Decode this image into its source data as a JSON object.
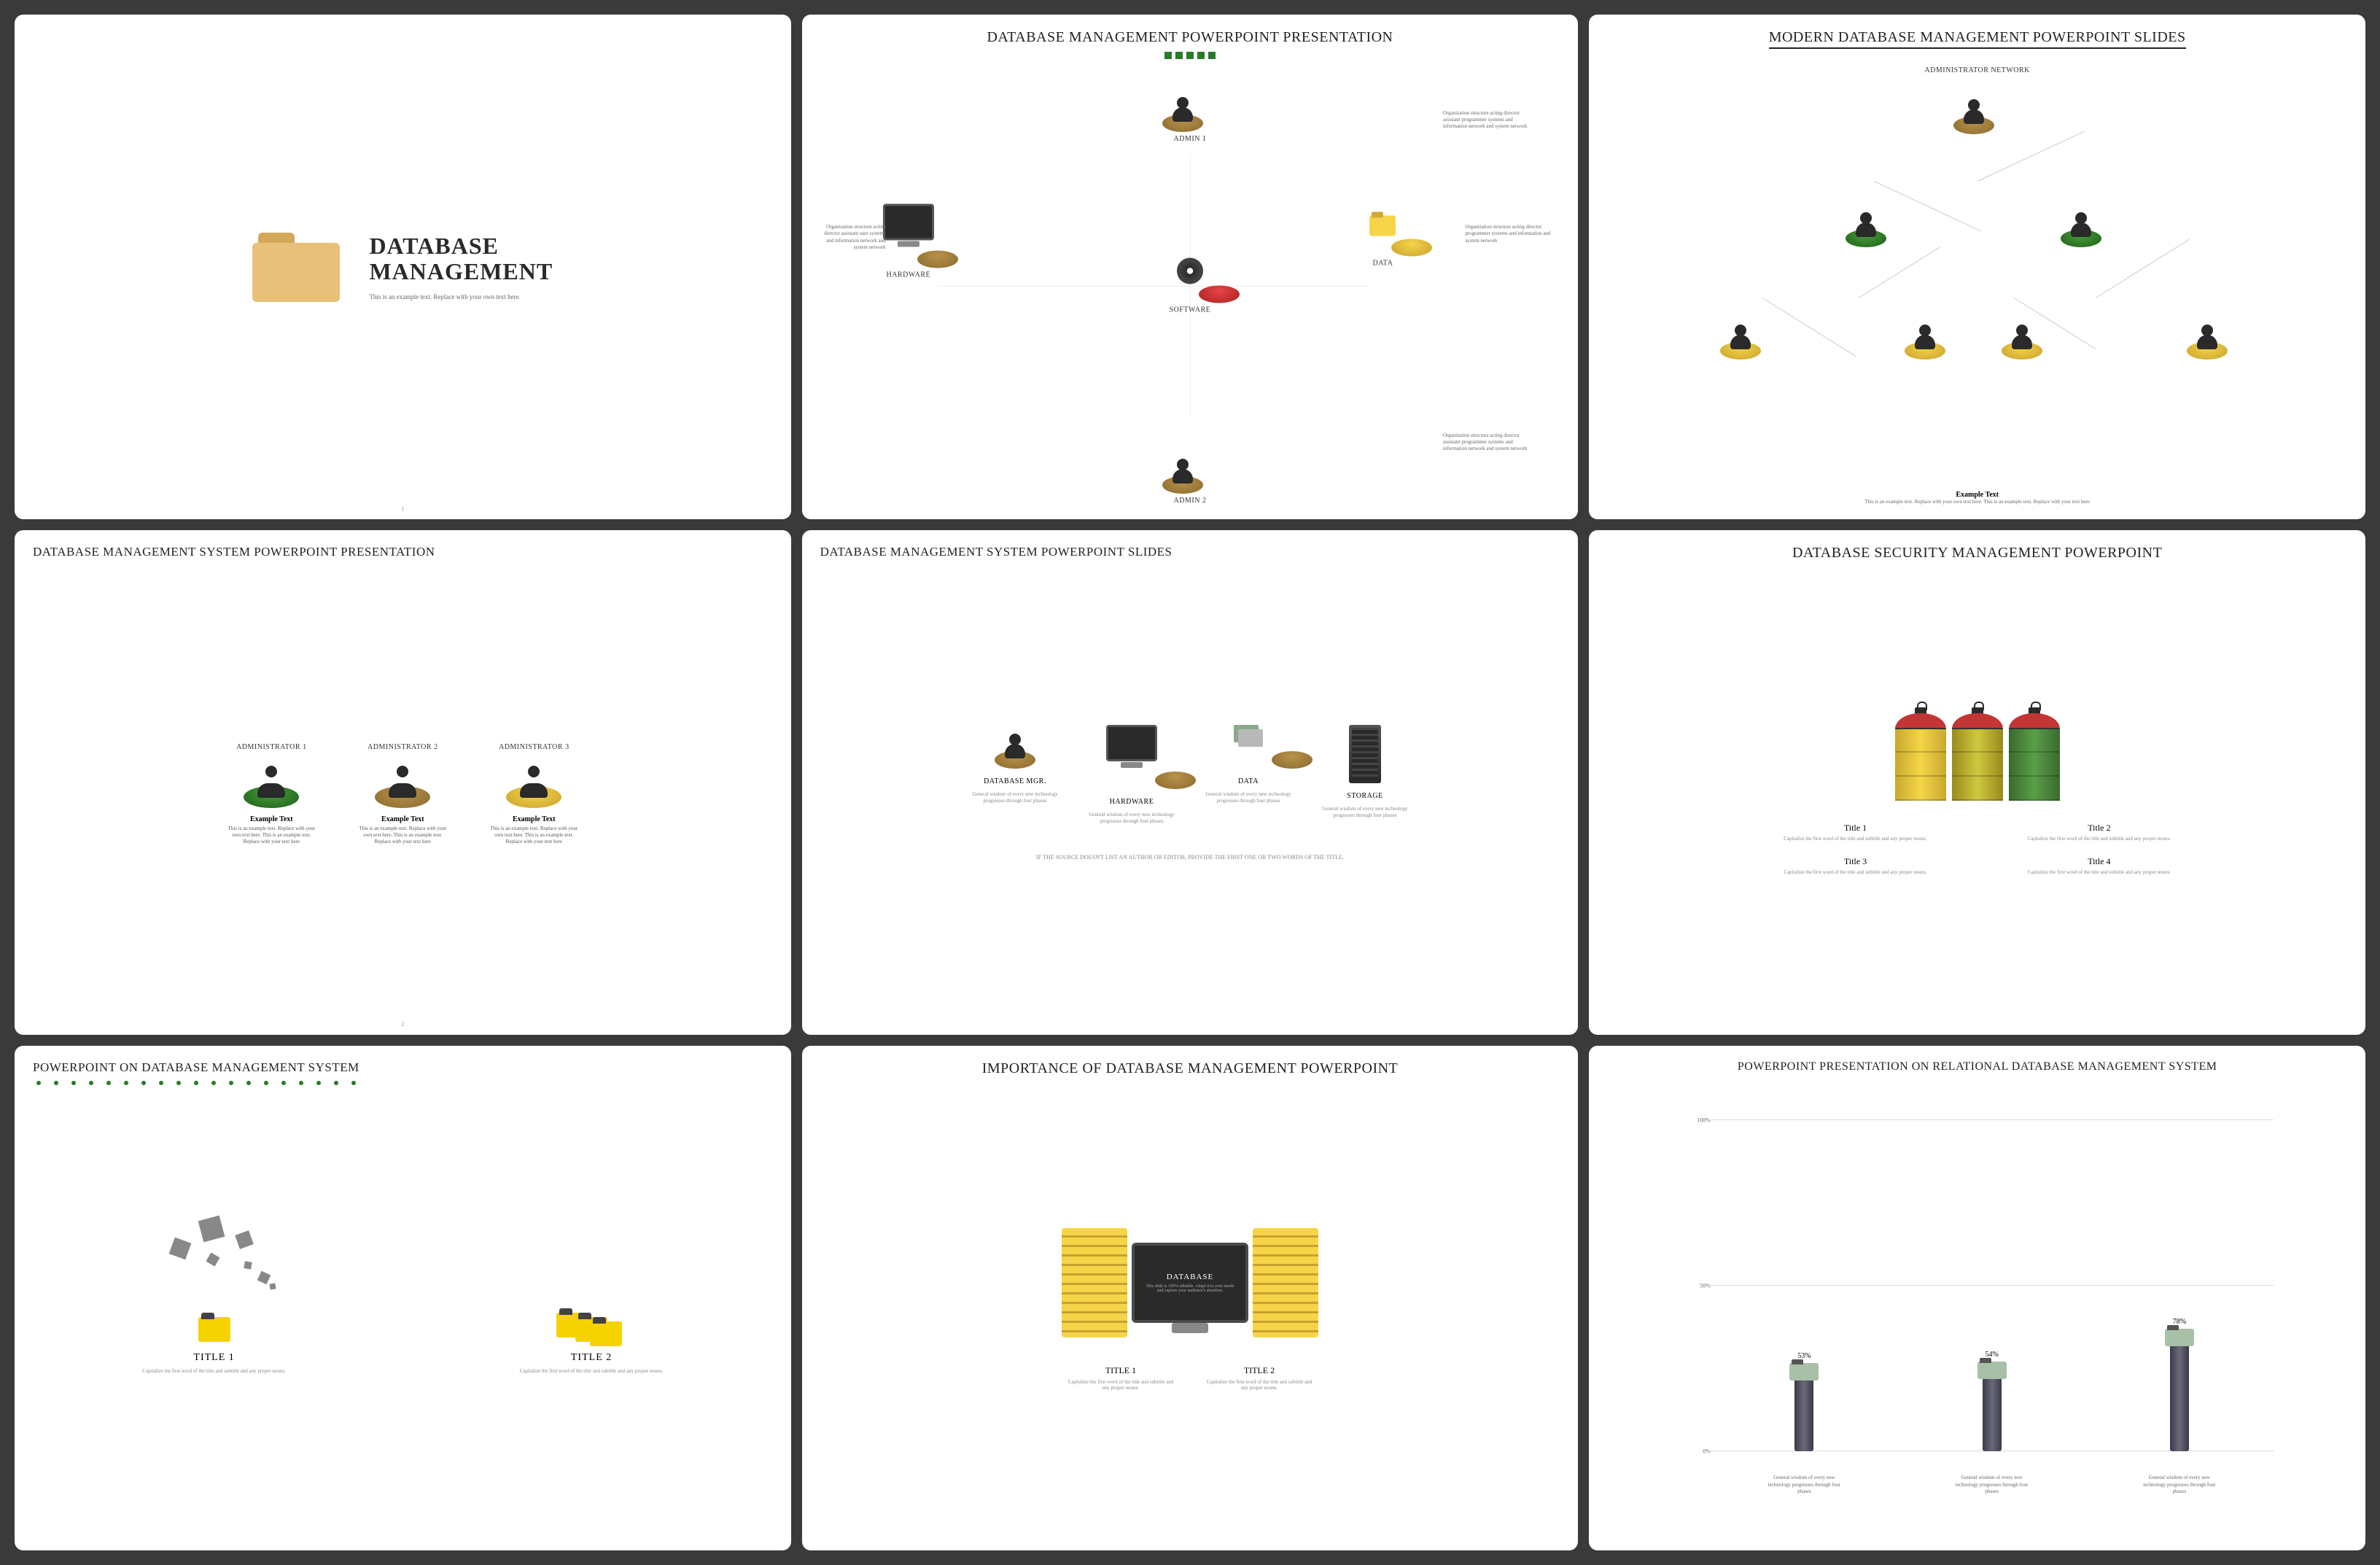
{
  "slides": [
    {
      "title1": "DATABASE",
      "title2": "MANAGEMENT",
      "subtitle": "This is an example text. Replace with your own text here.",
      "page": "1"
    },
    {
      "title": "DATABASE MANAGEMENT POWERPOINT PRESENTATION",
      "nodes": {
        "top": "ADMIN 1",
        "bottom": "ADMIN 2",
        "left": "HARDWARE",
        "right": "DATA",
        "center": "SOFTWARE"
      },
      "caption1": "Organization structure acting director assistant programmer systems and information network and system network",
      "caption2": "Organization structure acting director assistant user systems and information network and system network",
      "caption3": "Organization structure acting director programmer systems and information and system network",
      "caption4": "Organization structure acting director assistant programmer systems and information network and system network"
    },
    {
      "title": "MODERN DATABASE MANAGEMENT POWERPOINT SLIDES",
      "root_label": "ADMINISTRATOR NETWORK",
      "example_heading": "Example Text",
      "example_text": "This is an example text. Replace with your own text here. This is an example text. Replace with your text here"
    },
    {
      "title": "DATABASE MANAGEMENT SYSTEM POWERPOINT PRESENTATION",
      "items": [
        {
          "label": "ADMINISTRATOR 1",
          "heading": "Example Text",
          "text": "This is an example text. Replace with your own text here. This is an example text. Replace with your text here"
        },
        {
          "label": "ADMINISTRATOR 2",
          "heading": "Example Text",
          "text": "This is an example text. Replace with your own text here. This is an example text. Replace with your text here"
        },
        {
          "label": "ADMINISTRATOR 3",
          "heading": "Example Text",
          "text": "This is an example text. Replace with your own text here. This is an example text. Replace with your text here"
        }
      ],
      "page": "2"
    },
    {
      "title": "DATABASE MANAGEMENT SYSTEM POWERPOINT SLIDES",
      "items": [
        {
          "label": "DATABASE MGR.",
          "desc": "General wisdom of every new technology progresses through four phases"
        },
        {
          "label": "HARDWARE",
          "desc": "General wisdom of every new technology progresses through four phases"
        },
        {
          "label": "DATA",
          "desc": "General wisdom of every new technology progresses through four phases"
        },
        {
          "label": "STORAGE",
          "desc": "General wisdom of every new technology progresses through four phases"
        }
      ],
      "footnote": "IF THE SOURCE DOESN'T LIST AN AUTHOR OR EDITOR, PROVIDE THE FIRST ONE OR TWO WORDS OF THE TITLE."
    },
    {
      "title": "DATABASE SECURITY MANAGEMENT POWERPOINT",
      "titles": [
        {
          "h": "Title 1",
          "t": "Capitalize the first word of the title and subtitle and any proper nouns."
        },
        {
          "h": "Title 2",
          "t": "Capitalize the first word of the title and subtitle and any proper nouns."
        },
        {
          "h": "Title 3",
          "t": "Capitalize the first word of the title and subtitle and any proper nouns."
        },
        {
          "h": "Title 4",
          "t": "Capitalize the first word of the title and subtitle and any proper nouns."
        }
      ]
    },
    {
      "title": "POWERPOINT ON DATABASE MANAGEMENT SYSTEM",
      "items": [
        {
          "h": "TITLE 1",
          "t": "Capitalize the first word of the title and subtitle and any proper nouns."
        },
        {
          "h": "TITLE 2",
          "t": "Capitalize the first word of the title and subtitle and any proper nouns."
        }
      ]
    },
    {
      "title": "IMPORTANCE OF DATABASE MANAGEMENT POWERPOINT",
      "monitor_title": "DATABASE",
      "monitor_text": "This slide is 100% editable. Adapt it to your needs and capture your audience's attention.",
      "items": [
        {
          "h": "TITLE 1",
          "t": "Capitalize the first word of the title and subtitle and any proper nouns."
        },
        {
          "h": "TITLE 2",
          "t": "Capitalize the first word of the title and subtitle and any proper nouns."
        }
      ]
    },
    {
      "title": "POWERPOINT PRESENTATION ON RELATIONAL DATABASE MANAGEMENT SYSTEM"
    }
  ],
  "chart_data": {
    "type": "bar",
    "values": [
      53,
      54,
      78
    ],
    "ylim": [
      0,
      100
    ],
    "yticks": [
      "0%",
      "50%",
      "100%"
    ],
    "xlabels": [
      "General wisdom of every new technology progresses through four phases",
      "General wisdom of every new technology progresses through four phases",
      "General wisdom of every new technology progresses through four phases"
    ],
    "value_labels": [
      "53%",
      "54%",
      "78%"
    ]
  }
}
